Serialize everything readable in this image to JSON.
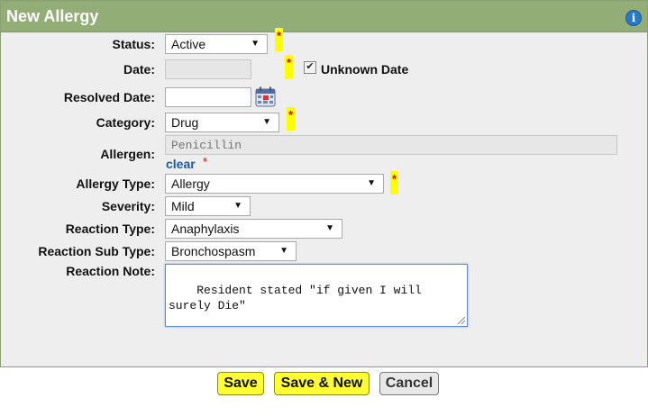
{
  "dialog": {
    "title": "New Allergy",
    "info_icon": "info-icon"
  },
  "form": {
    "status": {
      "label": "Status:",
      "value": "Active",
      "required": "*"
    },
    "date": {
      "label": "Date:",
      "value": "",
      "required": "*",
      "unknown_label": "Unknown Date",
      "unknown_checked": "✔"
    },
    "resolved_date": {
      "label": "Resolved Date:",
      "value": "",
      "icon": "calendar-icon"
    },
    "category": {
      "label": "Category:",
      "value": "Drug",
      "required": "*"
    },
    "allergen": {
      "label": "Allergen:",
      "value": "Penicillin",
      "clear_label": "clear",
      "required": "*"
    },
    "allergy_type": {
      "label": "Allergy Type:",
      "value": "Allergy",
      "required": "*"
    },
    "severity": {
      "label": "Severity:",
      "value": "Mild"
    },
    "reaction_type": {
      "label": "Reaction Type:",
      "value": "Anaphylaxis"
    },
    "reaction_sub_type": {
      "label": "Reaction Sub Type:",
      "value": "Bronchospasm"
    },
    "reaction_note": {
      "label": "Reaction Note:",
      "value": "Resident stated \"if given I will\nsurely Die\""
    }
  },
  "buttons": {
    "save": "Save",
    "save_new": "Save & New",
    "cancel": "Cancel"
  },
  "colors": {
    "title_bar": "#93ad76",
    "highlight": "#ffff00",
    "required": "#e00000",
    "link": "#1e5aa8"
  }
}
